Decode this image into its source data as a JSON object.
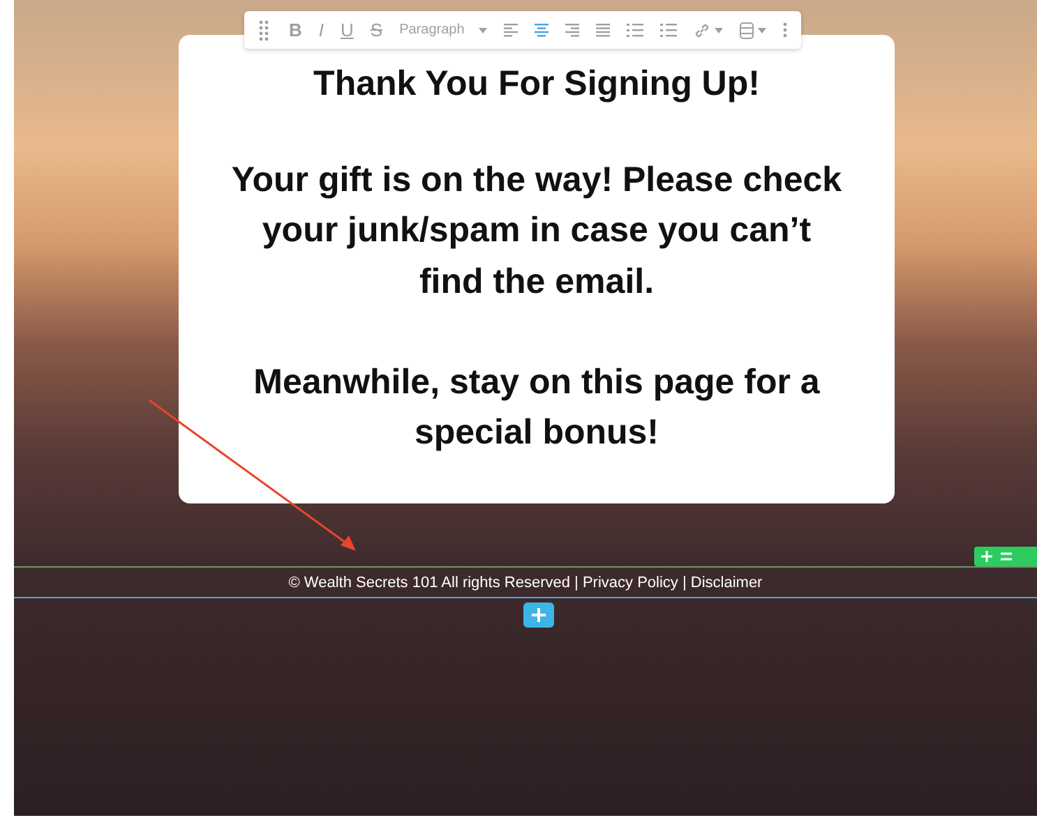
{
  "toolbar": {
    "items": [
      {
        "kind": "handle"
      },
      {
        "kind": "bold",
        "label": "B",
        "selected": false
      },
      {
        "kind": "italic",
        "label": "I",
        "selected": false
      },
      {
        "kind": "underline",
        "label": "U",
        "selected": false
      },
      {
        "kind": "strike",
        "label": "S",
        "selected": false
      },
      {
        "kind": "dropdown",
        "label": "Paragraph"
      },
      {
        "kind": "alignleft",
        "selected": false
      },
      {
        "kind": "aligncenter",
        "selected": true
      },
      {
        "kind": "alignright",
        "selected": false
      },
      {
        "kind": "justify",
        "selected": false
      },
      {
        "kind": "bullets"
      },
      {
        "kind": "numbers"
      },
      {
        "kind": "link"
      },
      {
        "kind": "block"
      },
      {
        "kind": "more"
      }
    ]
  },
  "card": {
    "title": "Thank You For Signing Up!",
    "paragraphs": [
      "Your gift is on the way! Please check your junk/spam in case you can’t find the email.",
      "Meanwhile, stay on this page for a special bonus!"
    ]
  },
  "footer": {
    "text": "© Wealth Secrets 101 All rights Reserved | Privacy Policy | Disclaimer"
  }
}
